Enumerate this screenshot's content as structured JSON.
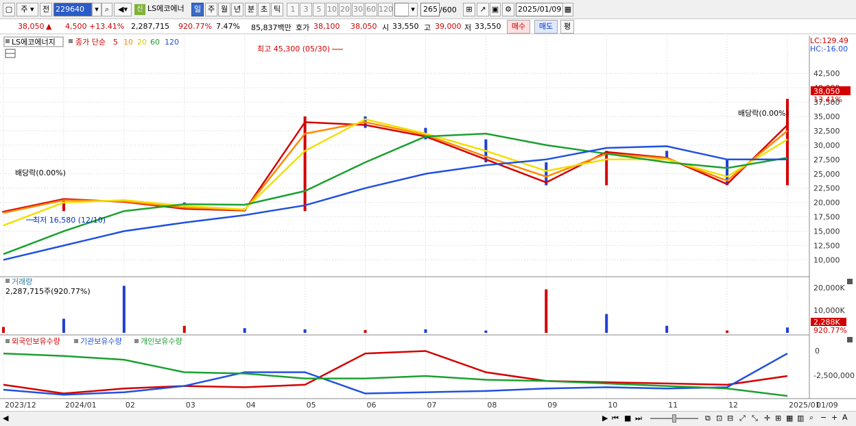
{
  "toolbar": {
    "period_main": "주",
    "prev_label": "전",
    "code": "229640",
    "credit_badge": "신",
    "stock_name": "LS에코에너",
    "periods": [
      "일",
      "주",
      "월",
      "년",
      "분",
      "초",
      "틱"
    ],
    "active_period": "일",
    "intervals": [
      "1",
      "3",
      "5",
      "10",
      "20",
      "30",
      "60",
      "120"
    ],
    "count_value": "265",
    "count_max": "/600",
    "date": "2025/01/09"
  },
  "quote": {
    "price": "38,050",
    "change_arrow": "▲",
    "change": "4,500",
    "change_pct": "+13.41%",
    "volume": "2,287,715",
    "volume_ratio": "920.77%",
    "turnover": "7.47%",
    "amount": "85,837백만",
    "ask_label": "호가",
    "ask_price": "38,100",
    "bid_price": "38,050",
    "open_label": "시",
    "open": "33,550",
    "high_label": "고",
    "high": "39,000",
    "low_label": "저",
    "low": "33,550",
    "buy_label": "매수",
    "sell_label": "매도",
    "eval_label": "평"
  },
  "price_panel": {
    "stock_tag": "LS에코에너지",
    "legend_prefix": "종가 단순",
    "ma_labels": [
      "5",
      "10",
      "20",
      "60",
      "120"
    ],
    "ma_colors": [
      "#d40000",
      "#ff8800",
      "#f0e000",
      "#1aa030",
      "#2050e0"
    ],
    "lc": "LC:129.49",
    "hc": "HC:-16.00",
    "current_price": "38,050",
    "current_pct": "13.41%",
    "high_note": "최고 45,300 (05/30)",
    "low_note": "최저 16,580 (12/10)",
    "dividend_left": "배당락(0.00%)",
    "dividend_right": "배당락(0.00%)",
    "y_ticks": [
      "42,500",
      "40,000",
      "37,500",
      "35,000",
      "32,500",
      "30,000",
      "27,500",
      "25,000",
      "22,500",
      "20,000",
      "17,500",
      "15,000",
      "12,500",
      "10,000"
    ]
  },
  "volume_panel": {
    "title": "거래량",
    "info": "2,287,715주(920.77%)",
    "y_ticks": [
      "20,000K",
      "10,000K"
    ],
    "current": "2,288K",
    "current_pct": "920.77%"
  },
  "holding_panel": {
    "legend": [
      "외국인보유수량",
      "기관보유수량",
      "개인보유수량"
    ],
    "legend_colors": [
      "#d40000",
      "#2050e0",
      "#1aa030"
    ],
    "y_ticks": [
      "0",
      "-2,500,000"
    ]
  },
  "x_axis": {
    "labels": [
      "2023/12",
      "2024/01",
      "02",
      "03",
      "04",
      "05",
      "06",
      "07",
      "08",
      "09",
      "10",
      "11",
      "12",
      "2025/01",
      "01/09"
    ]
  },
  "chart_data": {
    "type": "line",
    "title": "",
    "series": [
      {
        "name": "종가",
        "x": [
          "2023/12",
          "2024/01",
          "02",
          "03",
          "04",
          "05",
          "06",
          "07",
          "08",
          "09",
          "10",
          "11",
          "12",
          "2025/01"
        ],
        "values": [
          18500,
          20500,
          20000,
          19000,
          18500,
          35000,
          33000,
          31000,
          27000,
          23000,
          29000,
          27500,
          23000,
          38050
        ]
      },
      {
        "name": "5",
        "values": [
          18400,
          20600,
          20100,
          18900,
          18600,
          34000,
          33500,
          31500,
          27500,
          23500,
          28800,
          27800,
          23200,
          33500
        ]
      },
      {
        "name": "10",
        "values": [
          18200,
          20400,
          20200,
          19100,
          18700,
          32000,
          34000,
          31800,
          28000,
          24500,
          28500,
          27700,
          23800,
          32500
        ]
      },
      {
        "name": "20",
        "values": [
          16000,
          20000,
          20400,
          19400,
          18800,
          29000,
          34500,
          32000,
          29000,
          25500,
          27500,
          27500,
          24500,
          31000
        ]
      },
      {
        "name": "60",
        "values": [
          11000,
          15000,
          18500,
          19700,
          19600,
          22000,
          27000,
          31500,
          32000,
          30000,
          28500,
          27000,
          26000,
          27800
        ]
      },
      {
        "name": "120",
        "values": [
          10000,
          12500,
          15000,
          16500,
          17800,
          19500,
          22500,
          25000,
          26500,
          27500,
          29500,
          29800,
          27500,
          27500
        ]
      }
    ],
    "y_range": [
      8500,
      45500
    ],
    "volume_k": [
      2500,
      6000,
      20000,
      3000,
      2000,
      1500,
      1200,
      1500,
      1000,
      18500,
      8000,
      3000,
      1000,
      2288
    ],
    "holdings": {
      "foreign": [
        -2500000,
        -3200000,
        -2800000,
        -2600000,
        -2700000,
        -2500000,
        0,
        200000,
        -1500000,
        -2200000,
        -2300000,
        -2400000,
        -2500000,
        -1800000
      ],
      "institution": [
        -2900000,
        -3300000,
        -3100000,
        -2600000,
        -1500000,
        -1500000,
        -3200000,
        -3100000,
        -3000000,
        -2800000,
        -2700000,
        -2800000,
        -2700000,
        0
      ],
      "individual": [
        0,
        -200000,
        -500000,
        -1500000,
        -1600000,
        -2000000,
        -2000000,
        -1800000,
        -2100000,
        -2200000,
        -2400000,
        -2600000,
        -2800000,
        -3400000
      ]
    }
  }
}
